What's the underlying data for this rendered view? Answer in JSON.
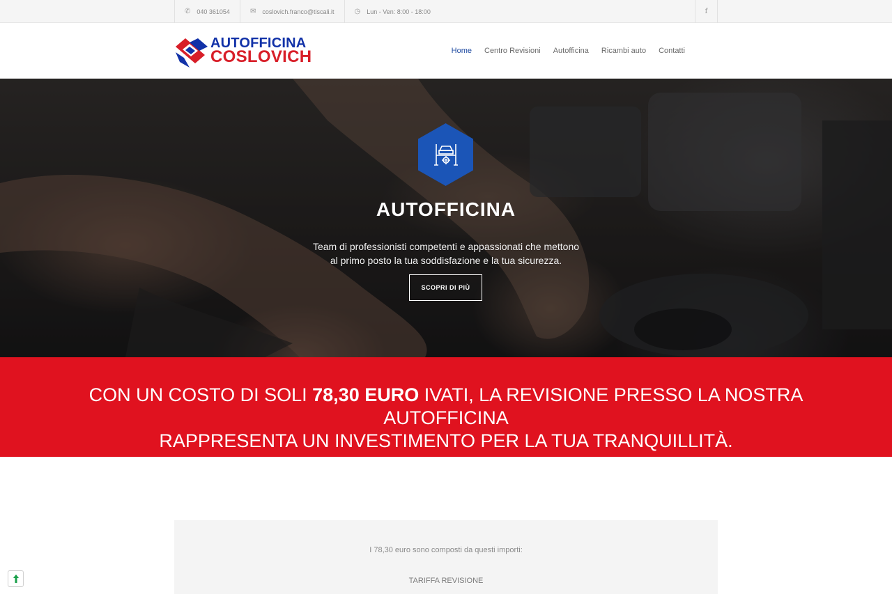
{
  "topbar": {
    "phone": "040 361054",
    "email": "coslovich.franco@tiscali.it",
    "hours": "Lun - Ven: 8:00 - 18:00",
    "social_icon": "f"
  },
  "brand": {
    "line1": "AUTOFFICINA",
    "line2": "COSLOVICH",
    "colors": {
      "blue": "#1232a8",
      "red": "#d81e28"
    }
  },
  "nav": {
    "items": [
      {
        "label": "Home",
        "active": true
      },
      {
        "label": "Centro Revisioni"
      },
      {
        "label": "Autofficina"
      },
      {
        "label": "Ricambi auto"
      },
      {
        "label": "Contatti"
      }
    ],
    "accent": "#1e4aa1"
  },
  "hero": {
    "icon": "car-lift-icon",
    "title": "AUTOFFICINA",
    "subtitle_line1": "Team di professionisti competenti e appassionati che mettono",
    "subtitle_line2": "al primo posto la tua soddisfazione e la tua sicurezza.",
    "button": "SCOPRI DI PIÙ"
  },
  "band": {
    "text_before": "CON UN COSTO DI SOLI ",
    "price": "78,30 EURO",
    "text_after": " IVATI, LA REVISIONE PRESSO LA NOSTRA AUTOFFICINA",
    "line2": "RAPPRESENTA UN INVESTIMENTO PER LA TUA TRANQUILLITÀ.",
    "color": "#e0121f"
  },
  "breakdown": {
    "intro": "I 78,30 euro sono composti da questi importi:",
    "item1": "TARIFFA REVISIONE"
  }
}
